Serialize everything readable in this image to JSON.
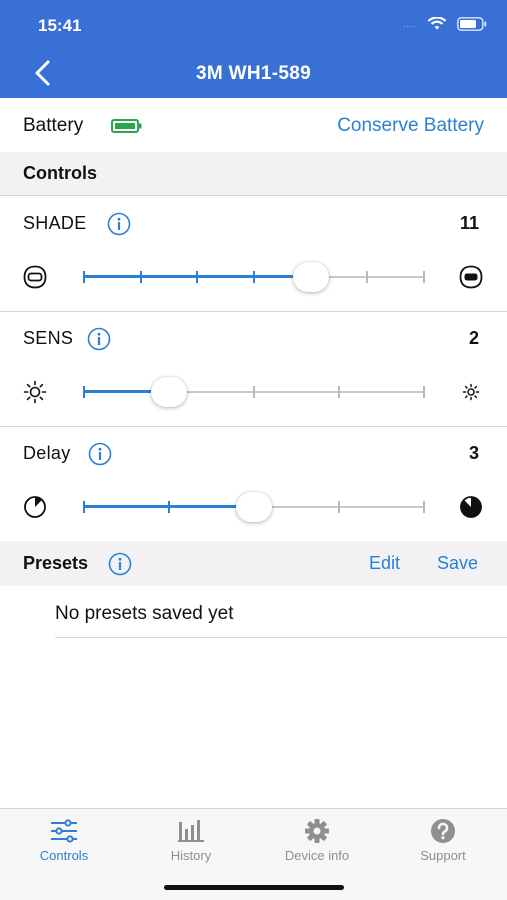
{
  "status_bar": {
    "time": "15:41",
    "signal_dots": "....",
    "icons": [
      "wifi-icon",
      "battery-icon"
    ]
  },
  "nav": {
    "title": "3M WH1-589",
    "back_icon": "chevron-left-icon"
  },
  "battery": {
    "label": "Battery",
    "icon": "battery-full-icon",
    "icon_color": "#2da44e",
    "action": "Conserve Battery"
  },
  "controls": {
    "title": "Controls",
    "settings": [
      {
        "label": "SHADE",
        "value": "11",
        "level": 0.667,
        "steps": 6,
        "left_icon": "shade-light-icon",
        "right_icon": "shade-dark-icon"
      },
      {
        "label": "SENS",
        "value": "2",
        "level": 0.25,
        "steps": 4,
        "left_icon": "sun-large-icon",
        "right_icon": "sun-small-icon"
      },
      {
        "label": "Delay",
        "value": "3",
        "level": 0.5,
        "steps": 4,
        "left_icon": "delay-short-icon",
        "right_icon": "delay-long-icon"
      }
    ]
  },
  "presets": {
    "title": "Presets",
    "edit": "Edit",
    "save": "Save",
    "empty_text": "No presets saved yet"
  },
  "tabs": [
    {
      "label": "Controls",
      "icon": "sliders-icon",
      "active": true
    },
    {
      "label": "History",
      "icon": "bar-chart-icon",
      "active": false
    },
    {
      "label": "Device info",
      "icon": "gear-icon",
      "active": false
    },
    {
      "label": "Support",
      "icon": "question-circle-icon",
      "active": false
    }
  ],
  "colors": {
    "header": "#3870d6",
    "accent": "#2b7fd4",
    "section_bg": "#f2f2f4",
    "inactive_tab": "#8e8e93"
  }
}
